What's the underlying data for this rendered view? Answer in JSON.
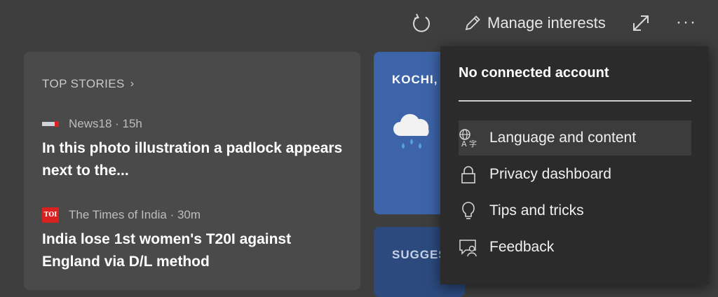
{
  "toolbar": {
    "manage_interests_label": "Manage interests",
    "refresh_icon": "refresh-icon",
    "edit_icon": "pencil-icon",
    "expand_icon": "expand-icon",
    "more_icon": "more-icon",
    "more_glyph": "···"
  },
  "top_stories": {
    "title": "TOP STORIES",
    "stories": [
      {
        "source": "News18 · 15h",
        "headline": "In this photo illustration a padlock appears next to the..."
      },
      {
        "source_logo_text": "TOI",
        "source": "The Times of India · 30m",
        "headline": "India lose 1st women's T20I against England via D/L method"
      }
    ]
  },
  "weather": {
    "city": "KOCHI, ",
    "icon": "rain-cloud-icon"
  },
  "suggested": {
    "label": "SUGGES"
  },
  "menu": {
    "title": "No connected account",
    "items": [
      {
        "label": "Language and content",
        "icon": "language-icon"
      },
      {
        "label": "Privacy dashboard",
        "icon": "lock-icon"
      },
      {
        "label": "Tips and tricks",
        "icon": "lightbulb-icon"
      },
      {
        "label": "Feedback",
        "icon": "feedback-icon"
      }
    ]
  },
  "colors": {
    "background": "#3e3e3e",
    "card": "#4a4a4a",
    "menu_bg": "#2b2b2b",
    "weather_card": "#3d64a8",
    "toi_red": "#d9221f"
  }
}
